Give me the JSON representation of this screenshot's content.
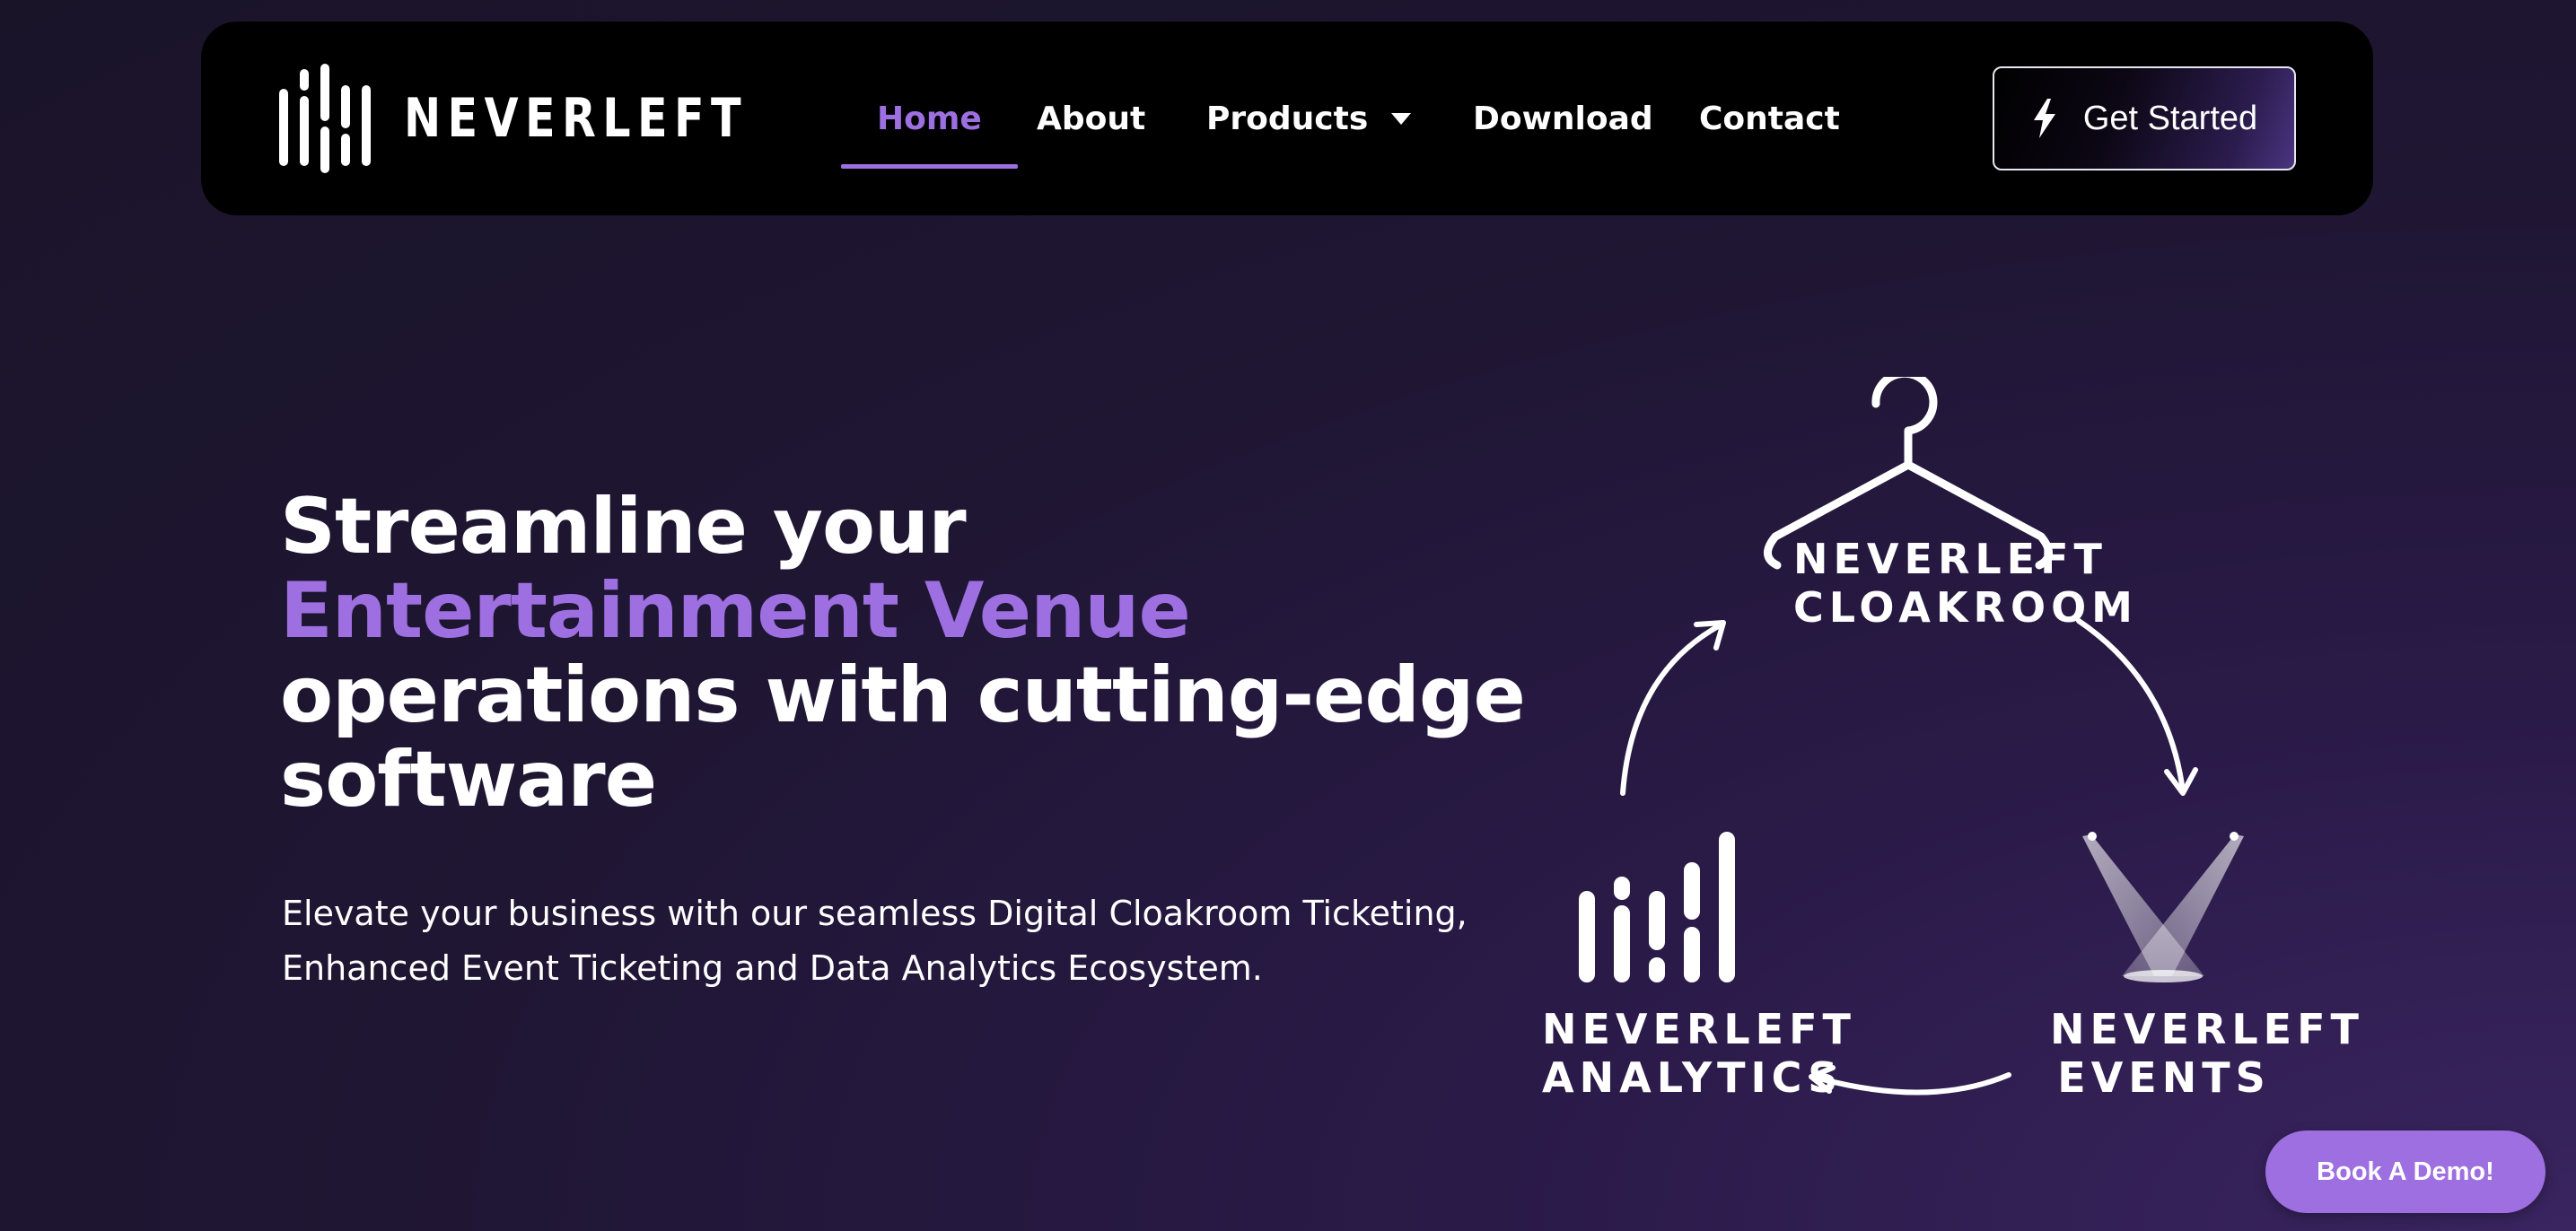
{
  "brand": {
    "name": "NEVERLEFT"
  },
  "nav": {
    "items": [
      {
        "label": "Home",
        "active": true
      },
      {
        "label": "About"
      },
      {
        "label": "Products",
        "has_dropdown": true
      },
      {
        "label": "Download"
      },
      {
        "label": "Contact"
      }
    ],
    "cta_label": "Get Started",
    "cta_icon": "bolt-icon"
  },
  "hero": {
    "title_line1": "Streamline your",
    "title_accent": "Entertainment Venue",
    "title_line3": "operations with cutting-edge",
    "title_line4": "software",
    "subtitle_line1": "Elevate your business with our seamless Digital Cloakroom Ticketing,",
    "subtitle_line2": "Enhanced Event Ticketing and Data Analytics Ecosystem."
  },
  "diagram": {
    "cloakroom": {
      "line1": "NEVERLEFT",
      "line2": "CLOAKROOM",
      "icon": "hanger-icon"
    },
    "events": {
      "line1": "NEVERLEFT",
      "line2": "EVENTS",
      "icon": "spotlight-icon"
    },
    "analytics": {
      "line1": "NEVERLEFT",
      "line2": "ANALYTICS",
      "icon": "bars-icon"
    }
  },
  "floating": {
    "book_demo_label": "Book A Demo!"
  },
  "colors": {
    "accent": "#9d6fe0",
    "navbar_bg": "#000000",
    "page_bg": "#1f1633"
  }
}
